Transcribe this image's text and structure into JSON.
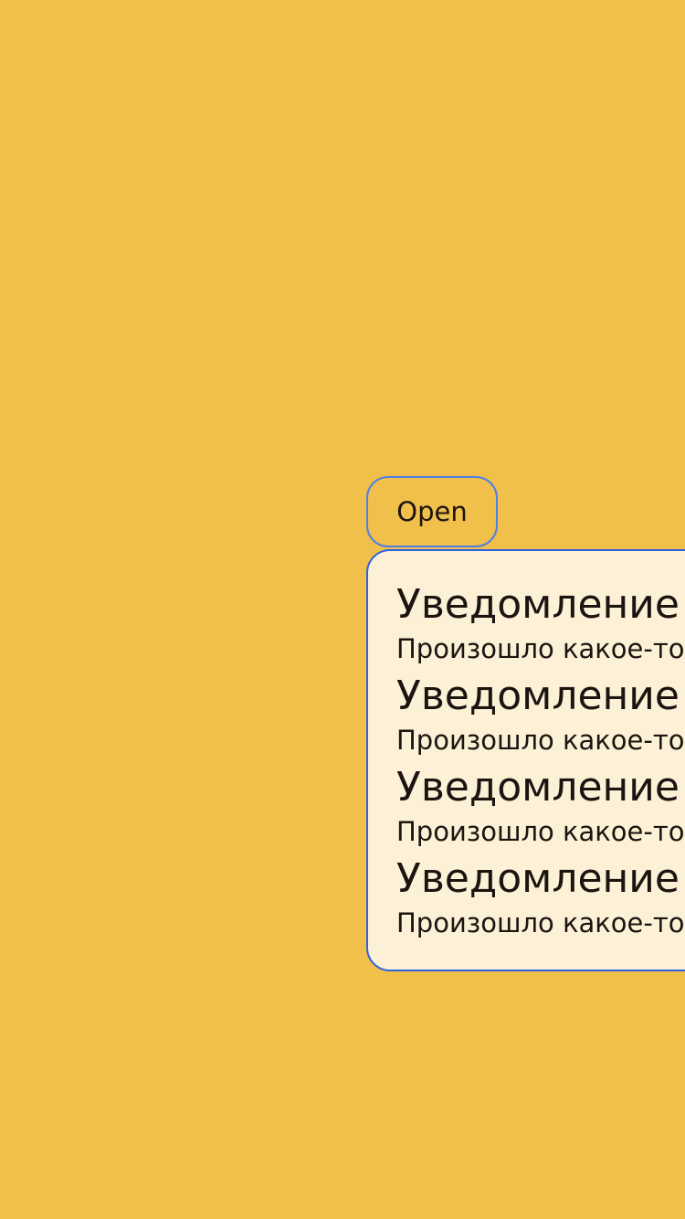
{
  "open_button": {
    "label": "Open"
  },
  "dropdown": {
    "items": [
      {
        "title": "Уведомление",
        "text": "Произошло какое-то событие"
      },
      {
        "title": "Уведомление",
        "text": "Произошло какое-то событие"
      },
      {
        "title": "Уведомление",
        "text": "Произошло какое-то событие"
      },
      {
        "title": "Уведомление",
        "text": "Произошло какое-то событие"
      }
    ]
  },
  "colors": {
    "background": "#f0c04a",
    "panel_background": "#fcf1d6",
    "panel_border": "#2f62dd",
    "button_border": "#4f7ee8",
    "text": "#1c1410"
  }
}
